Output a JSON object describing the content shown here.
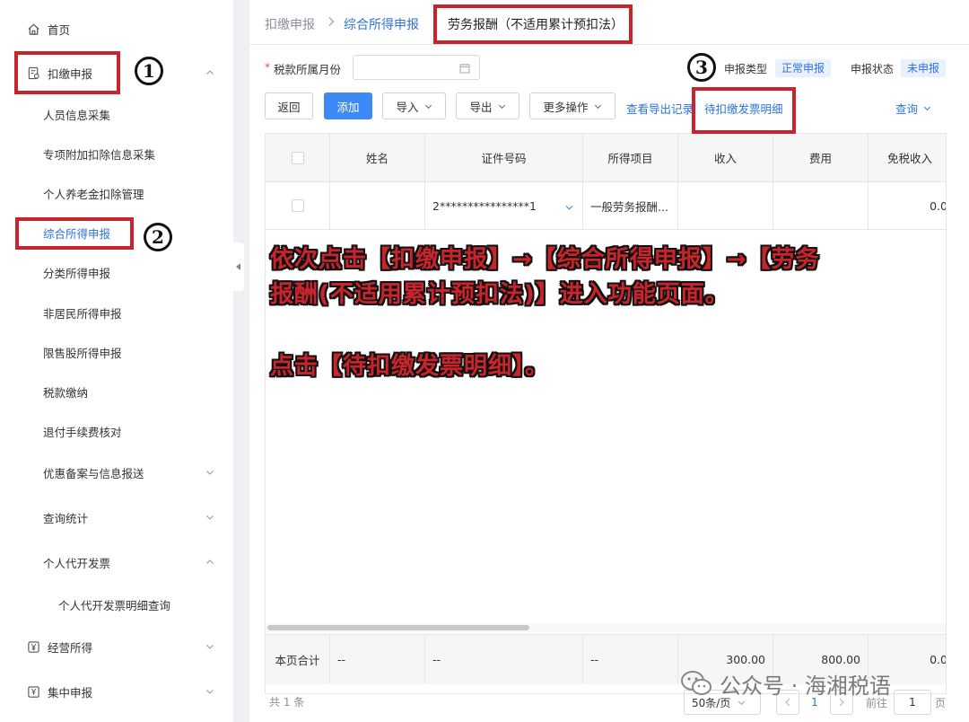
{
  "sidebar": {
    "home": "首页",
    "withhold": "扣缴申报",
    "sub": [
      "人员信息采集",
      "专项附加扣除信息采集",
      "个人养老金扣除管理",
      "综合所得申报",
      "分类所得申报",
      "非居民所得申报",
      "限售股所得申报",
      "税款缴纳",
      "退付手续费核对",
      "优惠备案与信息报送",
      "查询统计",
      "个人代开发票"
    ],
    "invoice_query": "个人代开发票明细查询",
    "business_income": "经营所得",
    "centralized": "集中申报"
  },
  "breadcrumb": {
    "l1": "扣缴申报",
    "l2": "综合所得申报",
    "l3": "劳务报酬（不适用累计预扣法）"
  },
  "form": {
    "required": "*",
    "month_label": "税款所属月份",
    "month_value": "",
    "type_label": "申报类型",
    "type_value": "正常申报",
    "status_label": "申报状态",
    "status_value": "未申报"
  },
  "toolbar": {
    "back": "返回",
    "add": "添加",
    "import": "导入",
    "export": "导出",
    "more": "更多操作",
    "export_records": "查看导出记录",
    "pending_invoice": "待扣缴发票明细",
    "query": "查询"
  },
  "table": {
    "headers": [
      "姓名",
      "证件号码",
      "所得项目",
      "收入",
      "费用",
      "免税收入"
    ],
    "row": {
      "name": "",
      "id": "2****************1",
      "item": "一般劳务报酬...",
      "income": "",
      "fee": "",
      "tax_free": "0.0"
    },
    "footer": {
      "label": "本页合计",
      "name": "--",
      "id": "--",
      "item": "--",
      "income": "300.00",
      "fee": "800.00",
      "tax_free": "0.0"
    }
  },
  "pager": {
    "total": "共 1 条",
    "page_size": "50条/页",
    "current": "1",
    "goto_label": "前往",
    "goto_value": "1",
    "page_unit": "页"
  },
  "annotations": {
    "n1": "1",
    "n2": "2",
    "n3": "3",
    "line1": "依次点击【扣缴申报】→【综合所得申报】→【劳务",
    "line2": "报酬(不适用累计预扣法)】进入功能页面。",
    "line3": "点击【待扣缴发票明细】。"
  },
  "watermark": "公众号 · 海湘税语",
  "colors": {
    "accent": "#2d73d9",
    "primary_btn": "#3d8af7",
    "annotation_red": "#c8242b"
  }
}
